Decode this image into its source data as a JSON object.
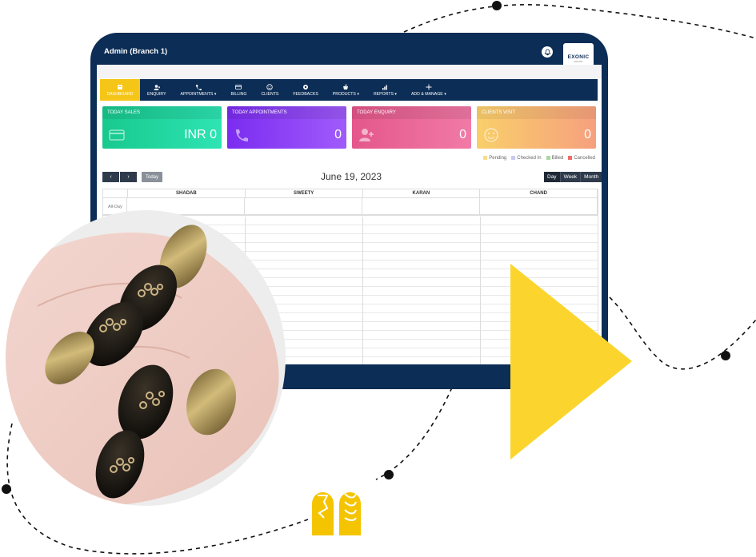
{
  "header": {
    "title": "Admin (Branch 1)",
    "logo_text": "EXONIC",
    "logo_sub": "SALON"
  },
  "nav": [
    {
      "label": "DASHBOARD",
      "icon": "dashboard-icon",
      "active": true
    },
    {
      "label": "ENQUIRY",
      "icon": "user-add-icon"
    },
    {
      "label": "APPOINTMENTS ▾",
      "icon": "phone-icon"
    },
    {
      "label": "BILLING",
      "icon": "card-icon"
    },
    {
      "label": "CLIENTS",
      "icon": "smiley-icon"
    },
    {
      "label": "FEEDBACKS",
      "icon": "gear-icon"
    },
    {
      "label": "PRODUCTS ▾",
      "icon": "cart-icon"
    },
    {
      "label": "REPORTS ▾",
      "icon": "chart-icon"
    },
    {
      "label": "ADD & MANAGE ▾",
      "icon": "plus-icon"
    }
  ],
  "cards": [
    {
      "title": "TODAY SALES",
      "value": "INR 0",
      "color": "#1dd6a0"
    },
    {
      "title": "TODAY APPOINTMENTS",
      "value": "0",
      "color": "#8a3cf5"
    },
    {
      "title": "TODAY ENQUIRY",
      "value": "0",
      "color": "#e8628f"
    },
    {
      "title": "CLIENTS VISIT",
      "value": "0",
      "color": "#f7b870"
    }
  ],
  "legend": [
    {
      "label": "Pending",
      "color": "#f9dc88"
    },
    {
      "label": "Checked In",
      "color": "#c9c9ef"
    },
    {
      "label": "Billed",
      "color": "#a8d8a0"
    },
    {
      "label": "Cancelled",
      "color": "#ef6b6b"
    }
  ],
  "calendar": {
    "prev": "‹",
    "next": "›",
    "today": "Today",
    "date": "June 19, 2023",
    "views": [
      "Day",
      "Week",
      "Month"
    ],
    "allday": "All-Day",
    "columns": [
      "SHADAB",
      "SWEETY",
      "KARAN",
      "CHAND"
    ]
  }
}
